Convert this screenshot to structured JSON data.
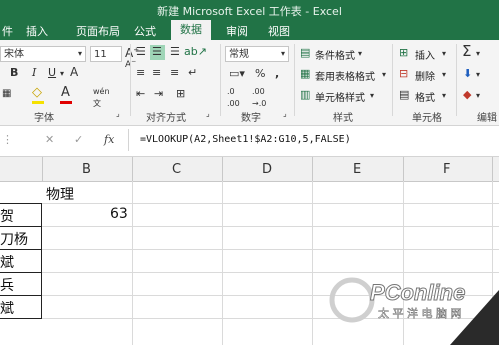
{
  "window": {
    "title": "新建 Microsoft Excel 工作表 - Excel"
  },
  "tabs": [
    "件",
    "插入",
    "页面布局",
    "公式",
    "数据",
    "审阅",
    "视图"
  ],
  "ribbon": {
    "font_name": "宋体",
    "font_size": "11",
    "font_group": "字体",
    "align_group": "对齐方式",
    "number_format": "常规",
    "number_group": "数字",
    "styles": {
      "conditional": "条件格式",
      "table": "套用表格格式",
      "cell": "单元格样式",
      "group": "样式"
    },
    "cells": {
      "insert": "插入",
      "delete": "删除",
      "format": "格式",
      "group": "单元格"
    },
    "editing_group": "编辑"
  },
  "formula_bar": {
    "fx": "fx",
    "cancel": "✕",
    "enter": "✓",
    "formula": "=VLOOKUP(A2,Sheet1!$A2:G10,5,FALSE)"
  },
  "columns": [
    "B",
    "C",
    "D",
    "E",
    "F"
  ],
  "cells": {
    "b1": "物理",
    "b2": "63",
    "a_col": [
      "贺",
      "刀杨",
      "斌",
      "兵",
      "斌"
    ]
  },
  "watermark": {
    "brand": "PConline",
    "subtitle": "太 平 洋 电 脑 网"
  }
}
